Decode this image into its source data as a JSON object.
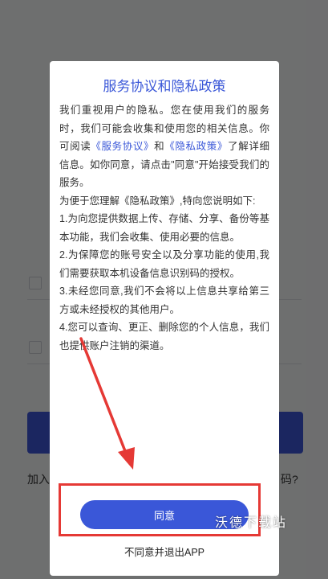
{
  "background": {
    "join_text": "加入",
    "forgot_text": "码?"
  },
  "dialog": {
    "title": "服务协议和隐私政策",
    "para1_part1": "我们重视用户的隐私。您在使用我们的服务时，我们可能会收集和使用您的相关信息。你可阅读",
    "service_link": "《服务协议》",
    "para1_and": "和",
    "privacy_link": "《隐私政策》",
    "para1_part2": "了解详细信息。如你同意，请点击\"同意\"开始接受我们的服务。",
    "para2": "为便于您理解《隐私政策》,特向您说明如下:",
    "item1": "1.为向您提供数据上传、存储、分享、备份等基本功能，我们会收集、使用必要的信息。",
    "item2": "2.为保障您的账号安全以及分享功能的使用,我们需要获取本机设备信息识别码的授权。",
    "item3": "3.未经您同意,我们不会将以上信息共享给第三方或未经授权的其他用户。",
    "item4": "4.您可以查询、更正、删除您的个人信息，我们也提供账户注销的渠道。",
    "agree_button": "同意",
    "decline_link": "不同意并退出APP"
  },
  "watermark": "沃德下载站",
  "colors": {
    "accent": "#3a57d8",
    "annotation": "#e53935"
  }
}
